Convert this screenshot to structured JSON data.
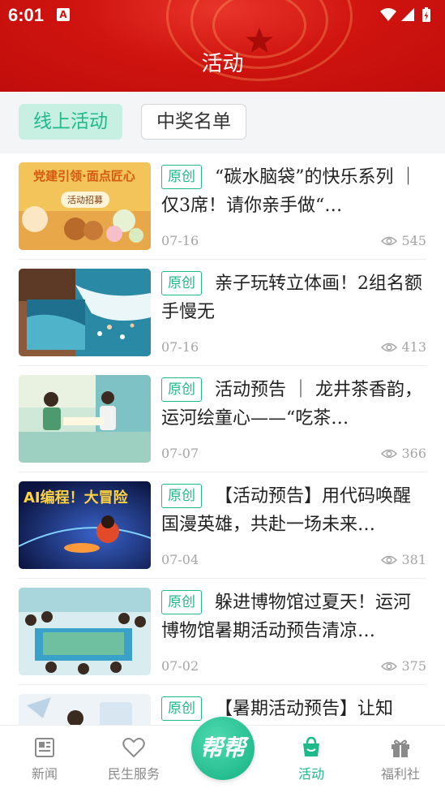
{
  "status_bar": {
    "time": "6:01",
    "notification_glyph": "A"
  },
  "header": {
    "title": "活动"
  },
  "tabs": [
    {
      "label": "线上活动",
      "active": true
    },
    {
      "label": "中奖名单",
      "active": false
    }
  ],
  "articles": [
    {
      "badge": "原创",
      "title": "“碳水脑袋”的快乐系列 ｜ 仅3席！请你亲手做“…",
      "date": "07-16",
      "views": "545",
      "thumb_text": "党建引领·面点匠心",
      "thumb_sub": "活动招募"
    },
    {
      "badge": "原创",
      "title": "亲子玩转立体画！2组名额手慢无",
      "date": "07-16",
      "views": "413"
    },
    {
      "badge": "原创",
      "title": "活动预告 ｜ 龙井茶香韵，运河绘童心——“吃茶…",
      "date": "07-07",
      "views": "366"
    },
    {
      "badge": "原创",
      "title": "【活动预告】用代码唤醒国漫英雄，共赴一场未来…",
      "date": "07-04",
      "views": "381",
      "thumb_text": "AI编程！大冒险"
    },
    {
      "badge": "原创",
      "title": "躲进博物馆过夏天！运河博物馆暑期活动预告清凉…",
      "date": "07-02",
      "views": "375"
    },
    {
      "badge": "原创",
      "title": "【暑期活动预告】让知",
      "date": "",
      "views": ""
    }
  ],
  "bottom_nav": {
    "items": [
      {
        "label": "新闻",
        "icon": "newspaper-icon",
        "active": false
      },
      {
        "label": "民生服务",
        "icon": "heart-icon",
        "active": false
      },
      {
        "label": "活动",
        "icon": "shopping-bag-icon",
        "active": true
      },
      {
        "label": "福利社",
        "icon": "gift-icon",
        "active": false
      }
    ],
    "center_button": "帮帮"
  },
  "colors": {
    "header_red": "#c8150f",
    "accent_green": "#1fb98a",
    "tab_active_bg": "#c8f0e2"
  }
}
